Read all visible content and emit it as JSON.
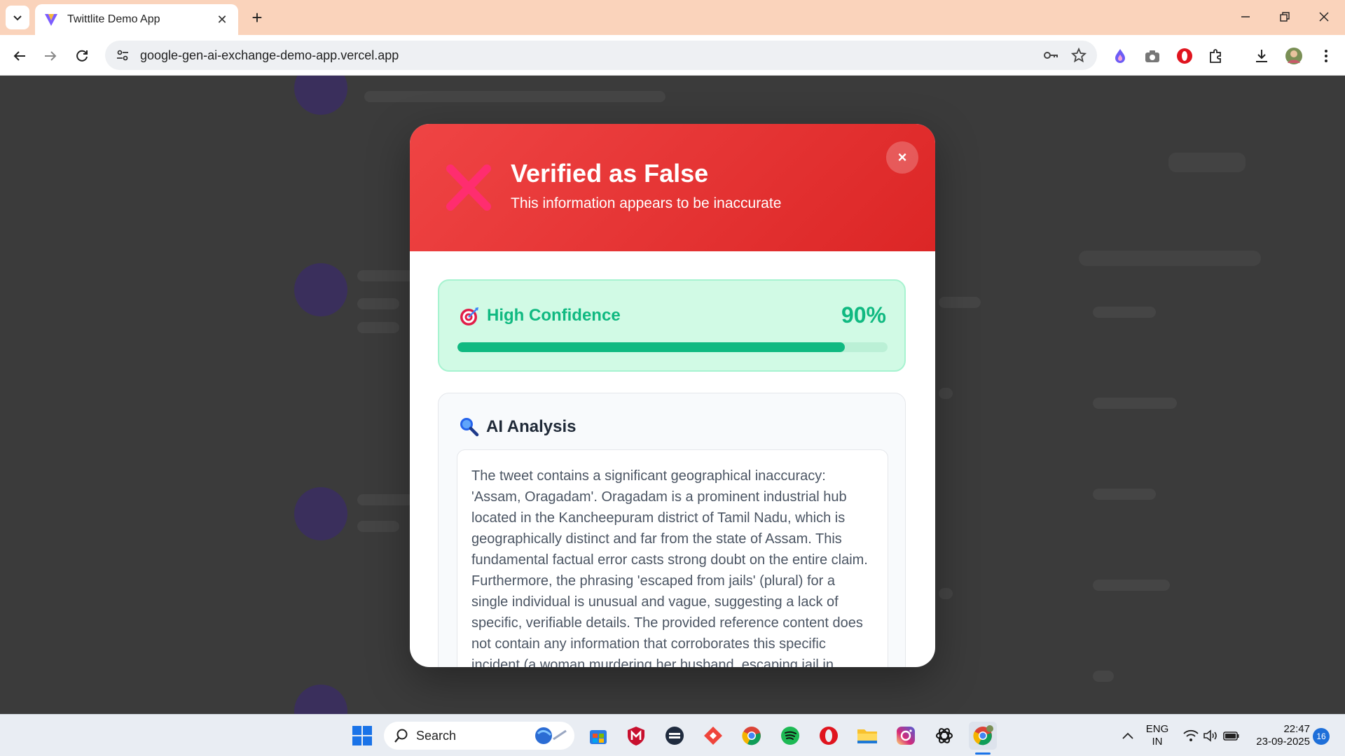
{
  "browser": {
    "tab_title": "Twittlite Demo App",
    "url": "google-gen-ai-exchange-demo-app.vercel.app"
  },
  "modal": {
    "title": "Verified as False",
    "subtitle": "This information appears to be inaccurate",
    "close_label": "×",
    "confidence": {
      "label": "High Confidence",
      "value_text": "90%",
      "value": 90
    },
    "analysis": {
      "title": "AI Analysis",
      "text": "The tweet contains a significant geographical inaccuracy: 'Assam, Oragadam'. Oragadam is a prominent industrial hub located in the Kancheepuram district of Tamil Nadu, which is geographically distinct and far from the state of Assam. This fundamental factual error casts strong doubt on the entire claim. Furthermore, the phrasing 'escaped from jails' (plural) for a single individual is unusual and vague, suggesting a lack of specific, verifiable details. The provided reference content does not contain any information that corroborates this specific incident (a woman murdering her husband, escaping jail in"
    },
    "colors": {
      "header": "#dc2626",
      "confidence": "#10b981"
    }
  },
  "taskbar": {
    "search_label": "Search",
    "language": "ENG",
    "region": "IN",
    "time": "22:47",
    "date": "23-09-2025",
    "notification_count": "16"
  }
}
